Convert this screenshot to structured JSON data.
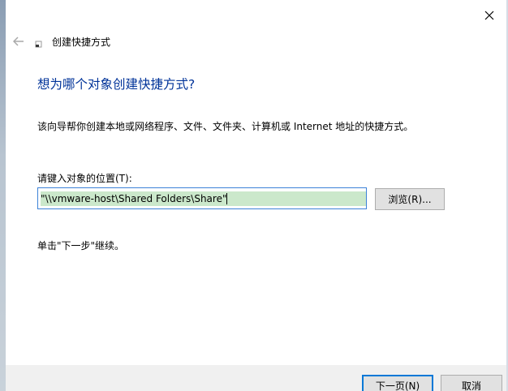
{
  "wizard": {
    "title": "创建快捷方式",
    "heading": "想为哪个对象创建快捷方式?",
    "description": "该向导帮你创建本地或网络程序、文件、文件夹、计算机或 Internet 地址的快捷方式。",
    "location_label": "请键入对象的位置(T):",
    "location_value": "\"\\\\vmware-host\\Shared Folders\\Share\"",
    "browse_label": "浏览(R)...",
    "hint": "单击\"下一步\"继续。"
  },
  "buttons": {
    "next": "下一页(N)",
    "cancel": "取消"
  },
  "icons": {
    "close": "close-icon",
    "back": "back-arrow-icon",
    "shortcut": "shortcut-wizard-icon"
  },
  "colors": {
    "heading": "#003399",
    "input_border": "#3c82d8",
    "selection": "#cbe8cb",
    "default_button_border": "#0078d7"
  }
}
